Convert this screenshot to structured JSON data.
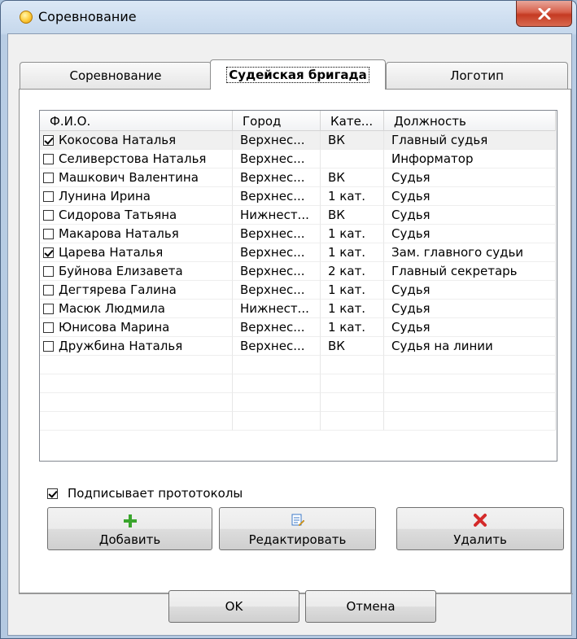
{
  "window": {
    "title": "Соревнование"
  },
  "tabs": [
    {
      "label": "Соревнование"
    },
    {
      "label": "Судейская бригада"
    },
    {
      "label": "Логотип"
    }
  ],
  "list": {
    "columns": [
      "Ф.И.О.",
      "Город",
      "Кате...",
      "Должность"
    ],
    "rows": [
      {
        "checked": true,
        "name": "Кокосова Наталья",
        "city": "Верхнес...",
        "category": "ВК",
        "position": "Главный судья"
      },
      {
        "checked": false,
        "name": "Селиверстова Наталья",
        "city": "Верхнес...",
        "category": "",
        "position": "Информатор"
      },
      {
        "checked": false,
        "name": "Машкович Валентина",
        "city": "Верхнес...",
        "category": "ВК",
        "position": "Судья"
      },
      {
        "checked": false,
        "name": "Лунина Ирина",
        "city": "Верхнес...",
        "category": "1 кат.",
        "position": "Судья"
      },
      {
        "checked": false,
        "name": "Сидорова Татьяна",
        "city": "Нижнест...",
        "category": "ВК",
        "position": "Судья"
      },
      {
        "checked": false,
        "name": "Макарова Наталья",
        "city": "Верхнес...",
        "category": "1 кат.",
        "position": "Судья"
      },
      {
        "checked": true,
        "name": "Царева Наталья",
        "city": "Верхнес...",
        "category": "1 кат.",
        "position": "Зам. главного судьи"
      },
      {
        "checked": false,
        "name": "Буйнова Елизавета",
        "city": "Верхнес...",
        "category": "2 кат.",
        "position": "Главный секретарь"
      },
      {
        "checked": false,
        "name": "Дегтярева Галина",
        "city": "Верхнес...",
        "category": "1 кат.",
        "position": "Судья"
      },
      {
        "checked": false,
        "name": "Масюк Людмила",
        "city": "Нижнест...",
        "category": "1 кат.",
        "position": "Судья"
      },
      {
        "checked": false,
        "name": "Юнисова Марина",
        "city": "Верхнес...",
        "category": "1 кат.",
        "position": "Судья"
      },
      {
        "checked": false,
        "name": "Дружбина Наталья",
        "city": "Верхнес...",
        "category": "ВК",
        "position": "Судья на линии"
      }
    ]
  },
  "signs_protocols": {
    "label": "Подписывает прототоколы",
    "checked": true
  },
  "buttons": {
    "add": "Добавить",
    "edit": "Редактировать",
    "delete": "Удалить",
    "ok": "OK",
    "cancel": "Отмена"
  },
  "colors": {
    "add_icon": "#3aa52d",
    "delete_icon": "#d42a2a",
    "edit_icon": "#3b78c8"
  }
}
